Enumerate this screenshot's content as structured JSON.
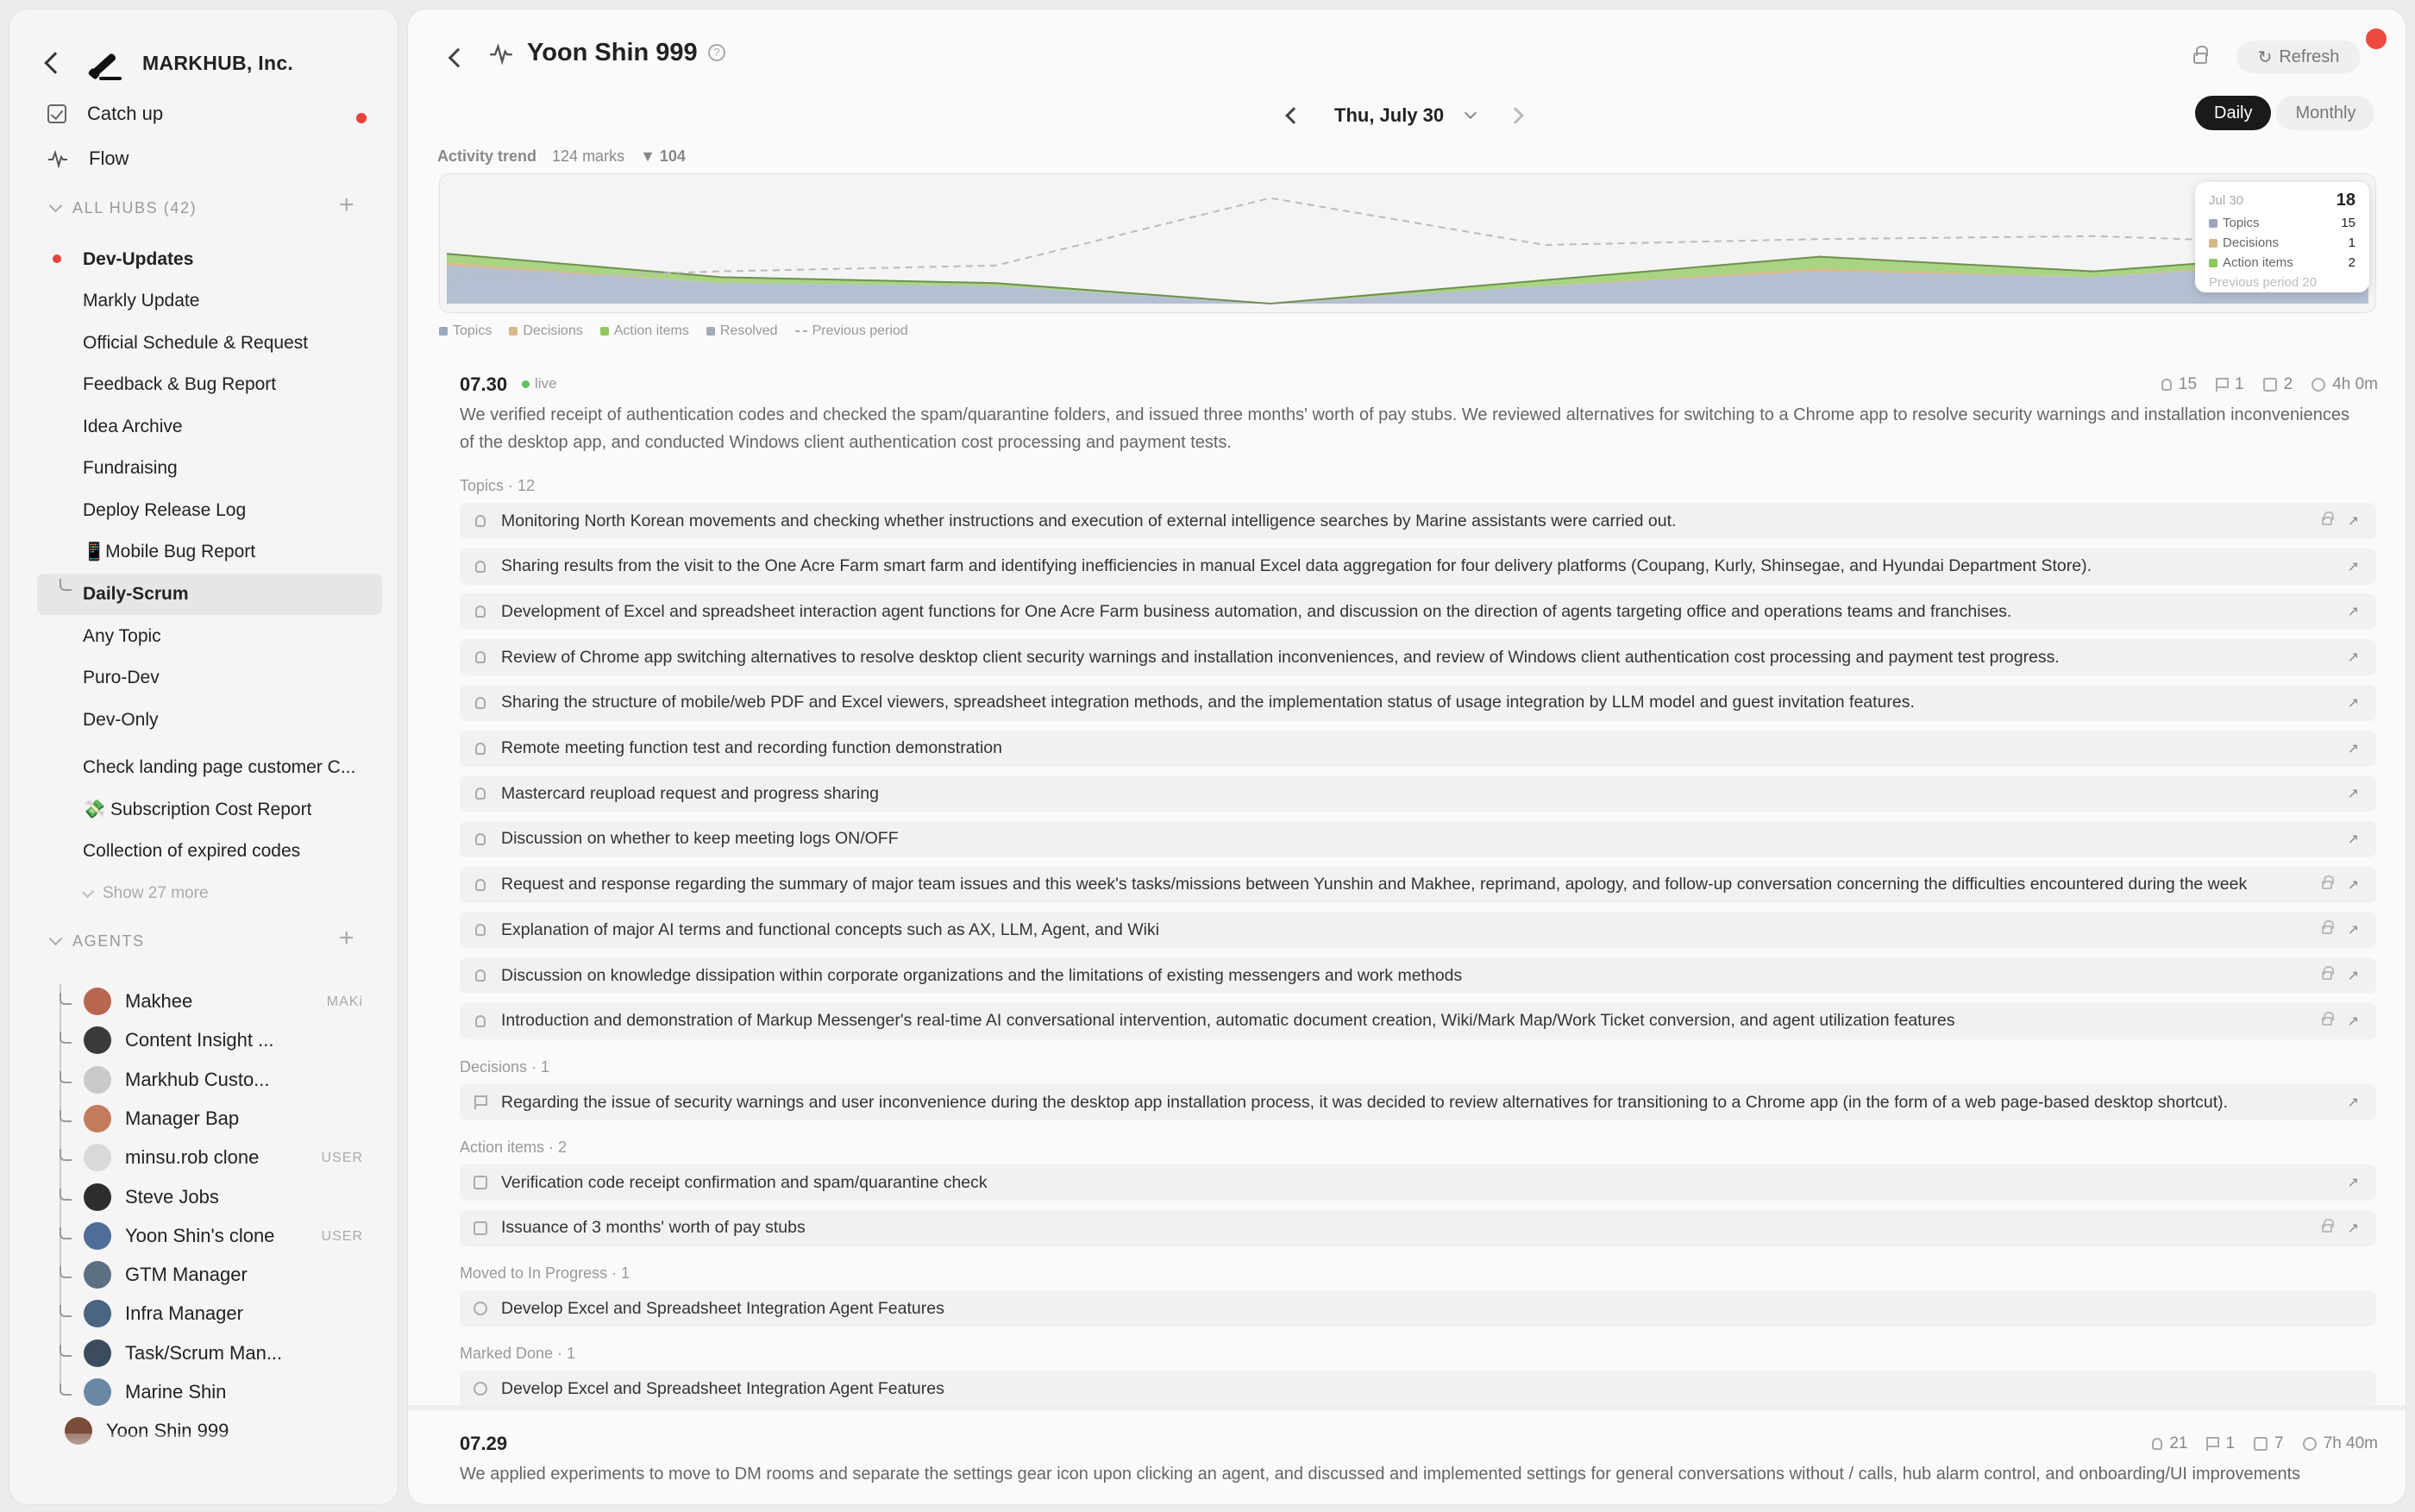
{
  "sidebar": {
    "org_name": "MARKHUB, Inc.",
    "nav": [
      {
        "label": "Catch up",
        "icon": "checkbox-icon",
        "unread": true
      },
      {
        "label": "Flow",
        "icon": "pulse-icon"
      }
    ],
    "hubs_header": "ALL HUBS (42)",
    "hubs": [
      "Dev-Updates",
      "Markly Update",
      "Official Schedule & Request",
      "Feedback & Bug Report",
      "Idea Archive",
      "Fundraising",
      "Deploy Release Log",
      "📱Mobile Bug Report",
      "Daily-Scrum",
      "Any Topic",
      "Puro-Dev",
      "Dev-Only",
      "Check landing page customer C...",
      "💸 Subscription Cost Report",
      "Collection of expired codes"
    ],
    "show_more": "Show 27 more",
    "agents_header": "AGENTS",
    "agents": [
      {
        "name": "Makhee",
        "tag": "MAKi",
        "color": "#b7674f"
      },
      {
        "name": "Content Insight ...",
        "tag": "",
        "color": "#3a3a3a"
      },
      {
        "name": "Markhub Custo...",
        "tag": "",
        "color": "#c9c9c9"
      },
      {
        "name": "Manager Bap",
        "tag": "",
        "color": "#c47b5c"
      },
      {
        "name": "minsu.rob clone",
        "tag": "USER",
        "color": "#d9d9d9"
      },
      {
        "name": "Steve Jobs",
        "tag": "",
        "color": "#2d2d2d"
      },
      {
        "name": "Yoon Shin's clone",
        "tag": "USER",
        "color": "#4f6d99"
      },
      {
        "name": "GTM Manager",
        "tag": "",
        "color": "#5d6f82"
      },
      {
        "name": "Infra Manager",
        "tag": "",
        "color": "#4a6583"
      },
      {
        "name": "Task/Scrum Man...",
        "tag": "",
        "color": "#3b4c5f"
      },
      {
        "name": "Marine Shin",
        "tag": "",
        "color": "#6b87a6"
      },
      {
        "name": "Yoon Shin 999",
        "tag": "",
        "color": "#7a4c3a"
      }
    ]
  },
  "header": {
    "title": "Yoon Shin 999",
    "refresh": "Refresh"
  },
  "datebar": {
    "date": "Thu, July 30",
    "daily": "Daily",
    "monthly": "Monthly"
  },
  "trend": {
    "label": "Activity trend",
    "marks": "124  marks",
    "delta": "▼ 104"
  },
  "chart_data": {
    "type": "area",
    "series": [
      {
        "name": "Topics",
        "color": "#b4bfd2",
        "values": [
          13,
          7,
          6,
          0,
          6,
          11,
          9,
          15
        ]
      },
      {
        "name": "Decisions",
        "color": "#d6b889",
        "values": [
          1,
          0,
          0,
          0,
          0,
          1,
          0,
          1
        ]
      },
      {
        "name": "Action items",
        "color": "#a8d483",
        "values": [
          3,
          2,
          1,
          0,
          2,
          4,
          2,
          2
        ]
      },
      {
        "name": "Previous period",
        "color": "#bbbbbb",
        "values": [
          8,
          11,
          13,
          36,
          20,
          22,
          23,
          20
        ]
      }
    ],
    "ylim": [
      0,
      40
    ],
    "tooltip": {
      "date": "Jul 30",
      "total": "18",
      "rows": [
        {
          "label": "Topics",
          "value": "15",
          "color": "#9aa7bd"
        },
        {
          "label": "Decisions",
          "value": "1",
          "color": "#d6b889"
        },
        {
          "label": "Action items",
          "value": "2",
          "color": "#8fc65e"
        }
      ],
      "prev": "Previous period  20"
    },
    "legend": [
      "Topics",
      "Decisions",
      "Action items",
      "Resolved",
      "Previous period"
    ]
  },
  "legend_colors": [
    "#9aa7bd",
    "#d6b889",
    "#8fc65e",
    "#a3aab5"
  ],
  "day1": {
    "date": "07.30",
    "live": "live",
    "stats": {
      "topics": "15",
      "decisions": "1",
      "actions": "2",
      "time": "4h 0m"
    },
    "summary": "We verified receipt of authentication codes and checked the spam/quarantine folders, and issued three months' worth of pay stubs. We reviewed alternatives for switching to a Chrome app to resolve security warnings and installation inconveniences of the desktop app, and conducted Windows client authentication cost processing and payment tests.",
    "topics_header": "Topics · 12",
    "topics": [
      "Monitoring North Korean movements and checking whether instructions and execution of external intelligence searches by Marine assistants were carried out.",
      "Sharing results from the visit to the One Acre Farm smart farm and identifying inefficiencies in manual Excel data aggregation for four delivery platforms (Coupang, Kurly, Shinsegae, and Hyundai Department Store).",
      "Development of Excel and spreadsheet interaction agent functions for One Acre Farm business automation, and discussion on the direction of agents targeting office and operations teams and franchises.",
      "Review of Chrome app switching alternatives to resolve desktop client security warnings and installation inconveniences, and review of Windows client authentication cost processing and payment test progress.",
      "Sharing the structure of mobile/web PDF and Excel viewers, spreadsheet integration methods, and the implementation status of usage integration by LLM model and guest invitation features.",
      "Remote meeting function test and recording function demonstration",
      "Mastercard reupload request and progress sharing",
      "Discussion on whether to keep meeting logs ON/OFF",
      "Request and response regarding the summary of major team issues and this week's tasks/missions between Yunshin and Makhee, reprimand, apology, and follow-up conversation concerning the difficulties encountered during the week",
      "Explanation of major AI terms and functional concepts such as AX, LLM, Agent, and Wiki",
      "Discussion on knowledge dissipation within corporate organizations and the limitations of existing messengers and work methods",
      "Introduction and demonstration of Markup Messenger's real-time AI conversational intervention, automatic document creation, Wiki/Mark Map/Work Ticket conversion, and agent utilization features"
    ],
    "topic_locks": [
      true,
      false,
      false,
      false,
      false,
      false,
      false,
      false,
      true,
      true,
      true,
      true
    ],
    "decisions_header": "Decisions · 1",
    "decisions": [
      "Regarding the issue of security warnings and user inconvenience during the desktop app installation process, it was decided to review alternatives for transitioning to a Chrome app (in the form of a web page-based desktop shortcut)."
    ],
    "actions_header": "Action items · 2",
    "actions": [
      "Verification code receipt confirmation and spam/quarantine check",
      "Issuance of 3 months' worth of pay stubs"
    ],
    "action_locks": [
      false,
      true
    ],
    "progress_header": "Moved to In Progress · 1",
    "progress": [
      "Develop Excel and Spreadsheet Integration Agent Features"
    ],
    "done_header": "Marked Done · 1",
    "done": [
      "Develop Excel and Spreadsheet Integration Agent Features"
    ]
  },
  "day2": {
    "date": "07.29",
    "stats": {
      "topics": "21",
      "decisions": "1",
      "actions": "7",
      "time": "7h 40m"
    },
    "summary": "We applied experiments to move to DM rooms and separate the settings gear icon upon clicking an agent, and discussed and implemented settings for general conversations without / calls, hub alarm control, and onboarding/UI improvements"
  }
}
